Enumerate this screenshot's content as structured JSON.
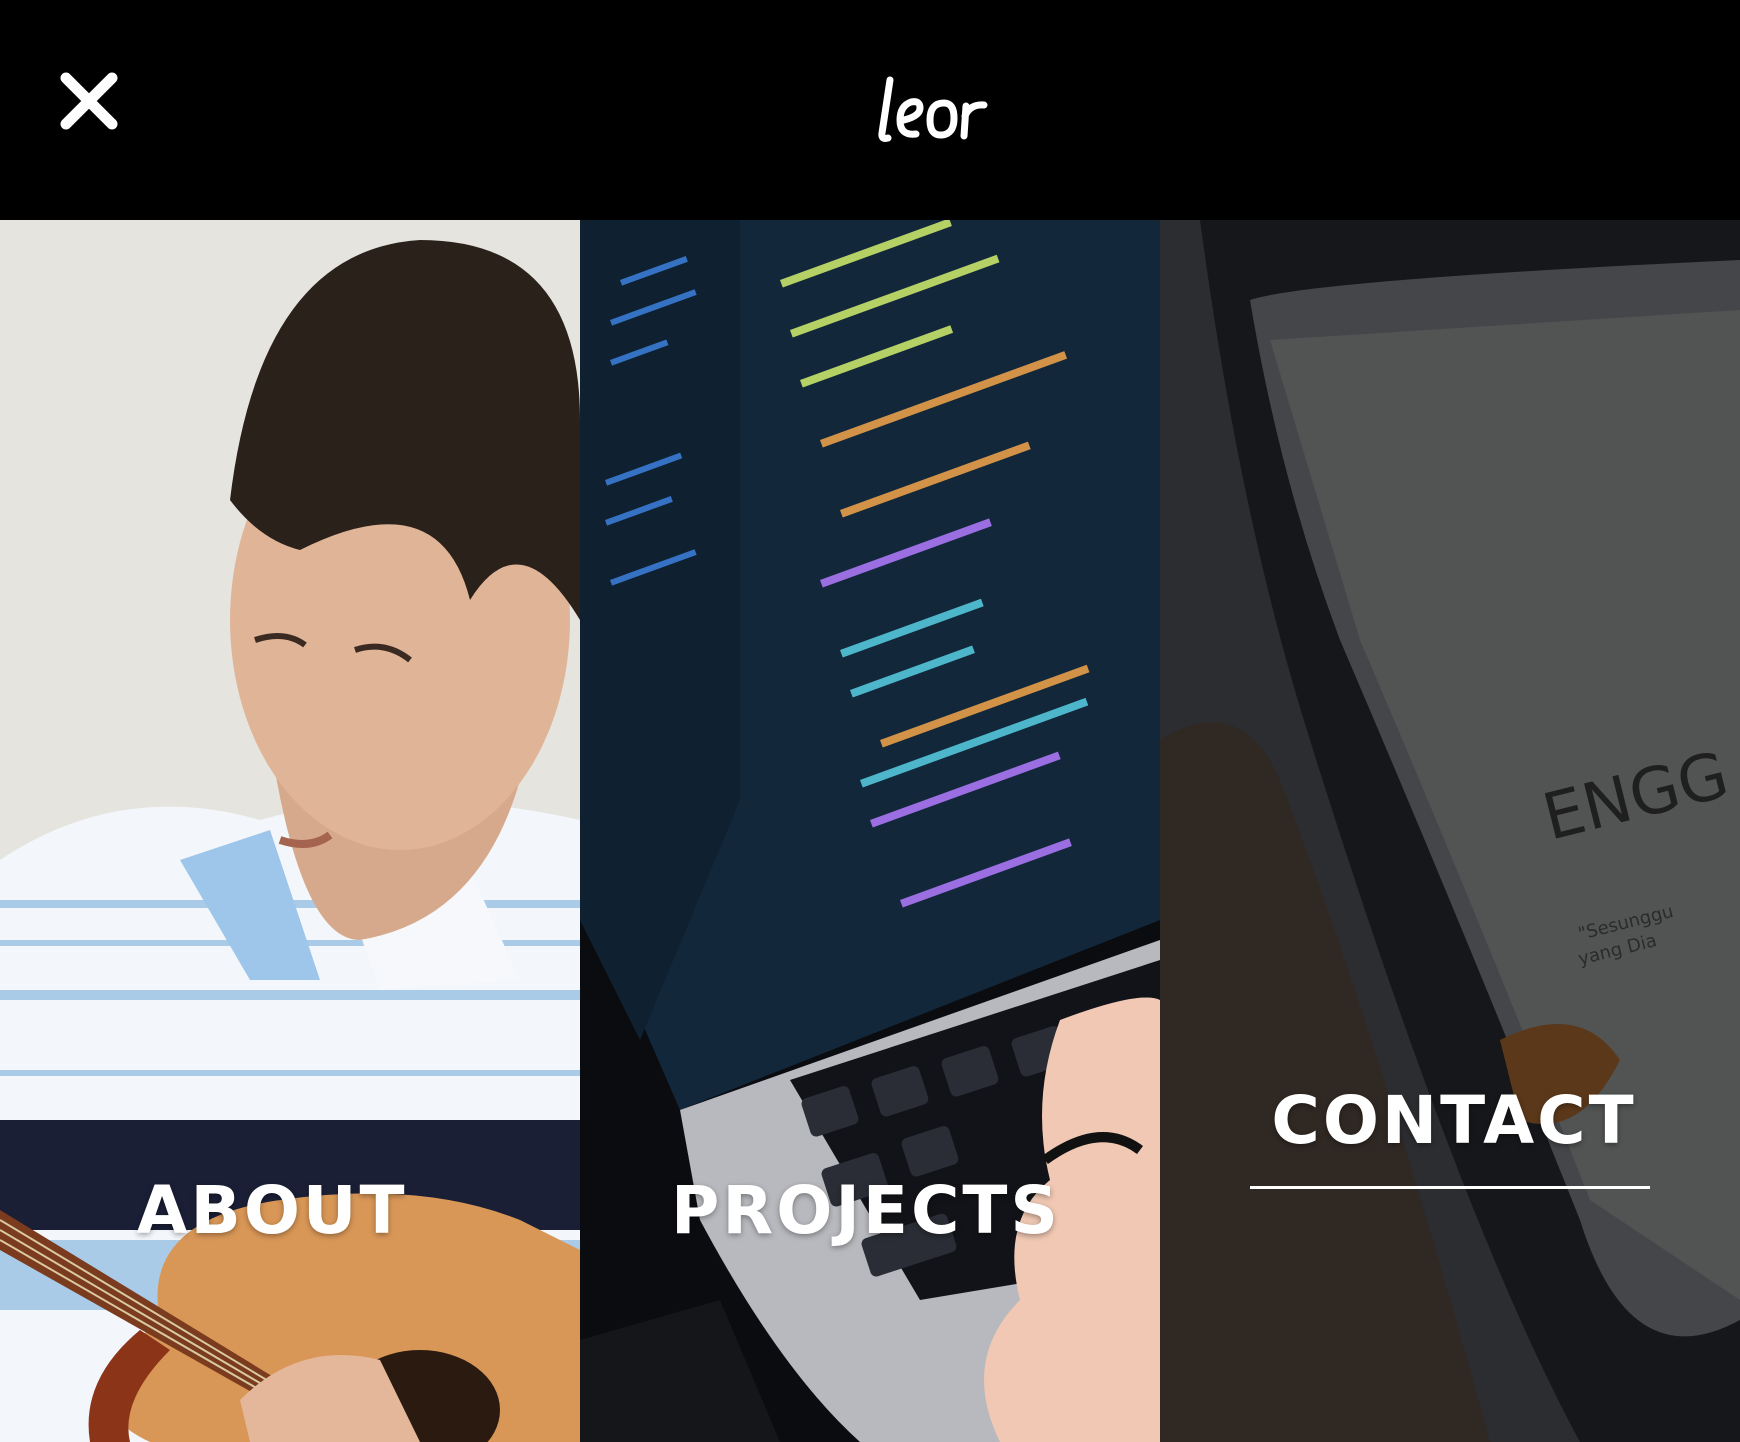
{
  "header": {
    "logo_text": "leor",
    "close_icon": "close-icon"
  },
  "panels": [
    {
      "id": "about",
      "label": "ABOUT",
      "active": false
    },
    {
      "id": "projects",
      "label": "PROJECTS",
      "active": false
    },
    {
      "id": "contact",
      "label": "CONTACT",
      "active": true
    }
  ],
  "colors": {
    "background": "#000000",
    "text": "#ffffff"
  }
}
